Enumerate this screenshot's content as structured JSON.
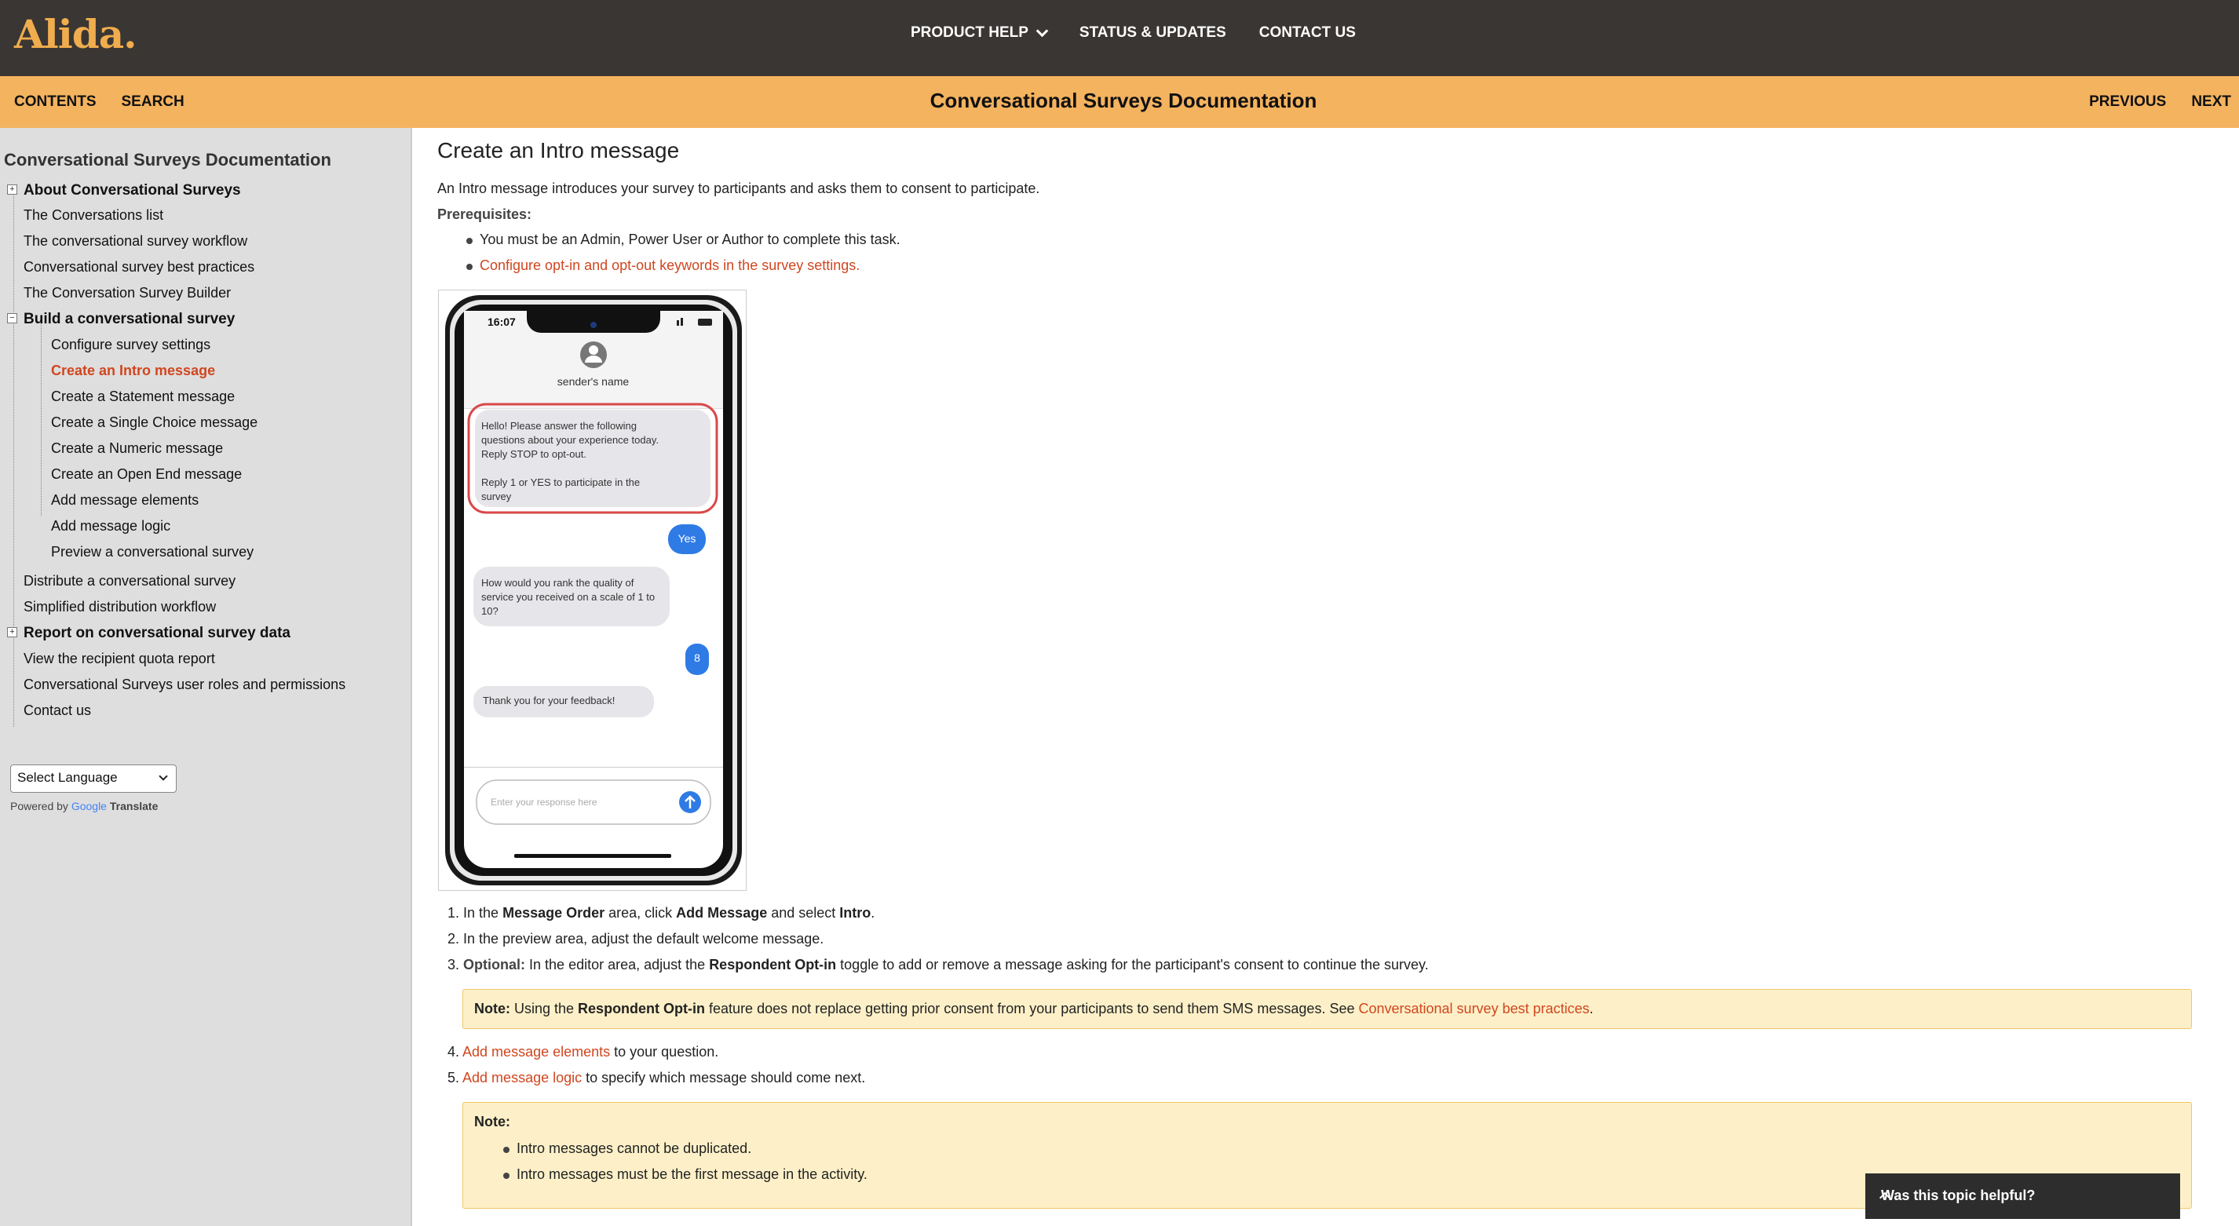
{
  "brand": {
    "logo": "Alida."
  },
  "topnav": {
    "product_help": "PRODUCT HELP",
    "status": "STATUS & UPDATES",
    "contact": "CONTACT US"
  },
  "subbar": {
    "contents": "CONTENTS",
    "search": "SEARCH",
    "title": "Conversational Surveys Documentation",
    "previous": "PREVIOUS",
    "next": "NEXT"
  },
  "sidebar": {
    "title": "Conversational Surveys Documentation",
    "items": [
      "About Conversational Surveys",
      "The Conversations list",
      "The conversational survey workflow",
      "Conversational survey best practices",
      "The Conversation Survey Builder",
      "Build a conversational survey",
      "Configure survey settings",
      "Create an Intro message",
      "Create a Statement message",
      "Create a Single Choice message",
      "Create a Numeric message",
      "Create an Open End message",
      "Add message elements",
      "Add message logic",
      "Preview a conversational survey",
      "Distribute a conversational survey",
      "Simplified distribution workflow",
      "Report on conversational survey data",
      "View the recipient quota report",
      "Conversational Surveys user roles and permissions",
      "Contact us"
    ],
    "language_select": "Select Language",
    "powered_by": "Powered by",
    "google": "Google",
    "translate": "Translate"
  },
  "content": {
    "heading": "Create an Intro message",
    "intro": "An Intro message introduces your survey to participants and asks them to consent to participate.",
    "prereq_label": "Prerequisites:",
    "prereq_1": "You must be an Admin, Power User or Author to complete this task.",
    "prereq_2": "Configure opt-in and opt-out keywords in the survey settings.",
    "steps": {
      "s1_num": "1.",
      "s1_a": "In the ",
      "s1_b": "Message Order",
      "s1_c": " area, click ",
      "s1_d": "Add Message",
      "s1_e": " and select ",
      "s1_f": "Intro",
      "s1_g": ".",
      "s2_num": "2.",
      "s2": "In the preview area, adjust the default welcome message.",
      "s3_num": "3.",
      "s3_a": "Optional:",
      "s3_b": " In the editor area, adjust the ",
      "s3_c": "Respondent Opt-in",
      "s3_d": " toggle to add or remove a message asking for the participant's consent to continue the survey.",
      "note1_a": "Note:",
      "note1_b": " Using the ",
      "note1_c": "Respondent Opt-in",
      "note1_d": " feature does not replace getting prior consent from your participants to send them SMS messages. See ",
      "note1_link": "Conversational survey best practices",
      "note1_e": ".",
      "s4_num": "4.",
      "s4_link": "Add message elements",
      "s4_b": " to your question.",
      "s5_num": "5.",
      "s5_link": "Add message logic",
      "s5_b": " to specify which message should come next.",
      "note2_label": "Note:",
      "note2_1": "Intro messages cannot be duplicated.",
      "note2_2": "Intro messages must be the first message in the activity."
    }
  },
  "phone": {
    "time": "16:07",
    "sender": "sender's name",
    "intro_msg_1": "Hello! Please answer the following",
    "intro_msg_2": "questions about your experience today.",
    "intro_msg_3": "Reply STOP to opt-out.",
    "intro_msg_4": "Reply 1 or YES to participate in the",
    "intro_msg_5": "survey",
    "reply_yes": "Yes",
    "q_1": "How would you rank the quality of",
    "q_2": "service you received on a scale of 1 to",
    "q_3": "10?",
    "reply_8": "8",
    "thanks": "Thank you for your feedback!",
    "input_placeholder": "Enter your response here"
  },
  "feedback": {
    "label": "Was this topic helpful?"
  },
  "colors": {
    "topbar": "#3a3633",
    "accent": "#f4b35f",
    "link": "#d0461f",
    "note_bg": "#fdf0c8"
  }
}
